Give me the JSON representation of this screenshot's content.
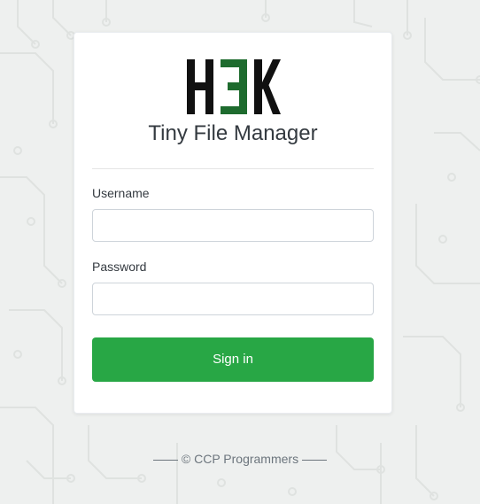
{
  "brand": {
    "logo_text": "H3K",
    "logo_color_dark": "#111111",
    "logo_color_accent": "#1e6b2e",
    "title": "Tiny File Manager"
  },
  "form": {
    "username_label": "Username",
    "username_value": "",
    "password_label": "Password",
    "password_value": "",
    "submit_label": "Sign in"
  },
  "footer": {
    "text": "© CCP Programmers"
  },
  "colors": {
    "accent": "#28a745",
    "background": "#eef0ef",
    "card": "#ffffff"
  }
}
